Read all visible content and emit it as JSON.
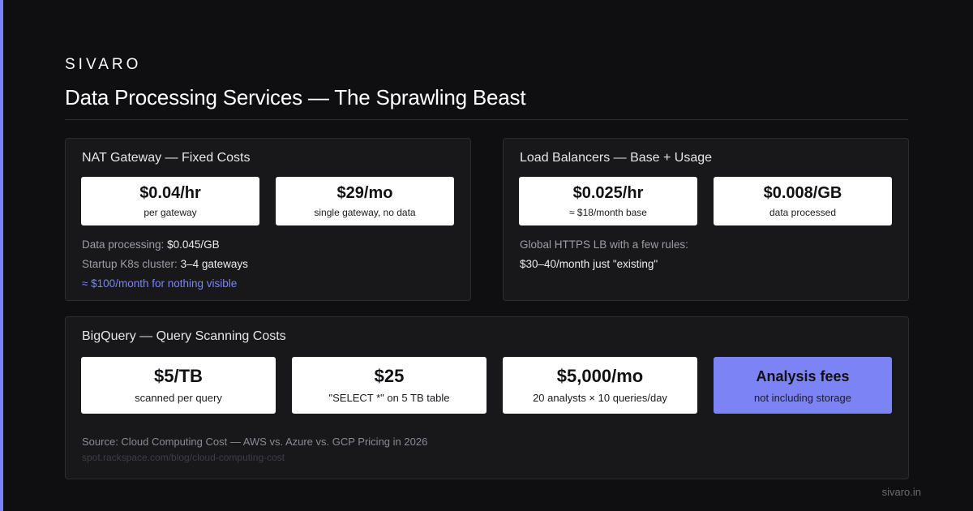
{
  "header": {
    "brand": "SIVARO",
    "title": "Data Processing Services — The Sprawling Beast"
  },
  "colors": {
    "accent": "#7c83f5",
    "background": "#0f0f11",
    "panel": "#18181b"
  },
  "nat_gateway": {
    "title": "NAT Gateway — Fixed Costs",
    "cards": [
      {
        "value": "$0.04/hr",
        "label": "per gateway"
      },
      {
        "value": "$29/mo",
        "label": "single gateway, no data"
      }
    ],
    "lines": [
      {
        "key": "Data processing:",
        "value": "$0.045/GB"
      },
      {
        "key": "Startup K8s cluster:",
        "value": "3–4 gateways"
      }
    ],
    "highlight": "≈ $100/month for nothing visible"
  },
  "load_balancers": {
    "title": "Load Balancers — Base + Usage",
    "cards": [
      {
        "value": "$0.025/hr",
        "label": "≈ $18/month base"
      },
      {
        "value": "$0.008/GB",
        "label": "data processed"
      }
    ],
    "note": "Global HTTPS LB with a few rules:",
    "note_value": "$30–40/month just \"existing\""
  },
  "bigquery": {
    "title": "BigQuery — Query Scanning Costs",
    "cards": [
      {
        "value": "$5/TB",
        "label": "scanned per query"
      },
      {
        "value": "$25",
        "label": "\"SELECT *\" on 5 TB table"
      },
      {
        "value": "$5,000/mo",
        "label": "20 analysts × 10 queries/day"
      },
      {
        "value": "Analysis fees",
        "label": "not including storage"
      }
    ],
    "source": "Source: Cloud Computing Cost — AWS vs. Azure vs. GCP Pricing in 2026",
    "source_url": "spot.rackspace.com/blog/cloud-computing-cost"
  },
  "footer": "sivaro.in"
}
